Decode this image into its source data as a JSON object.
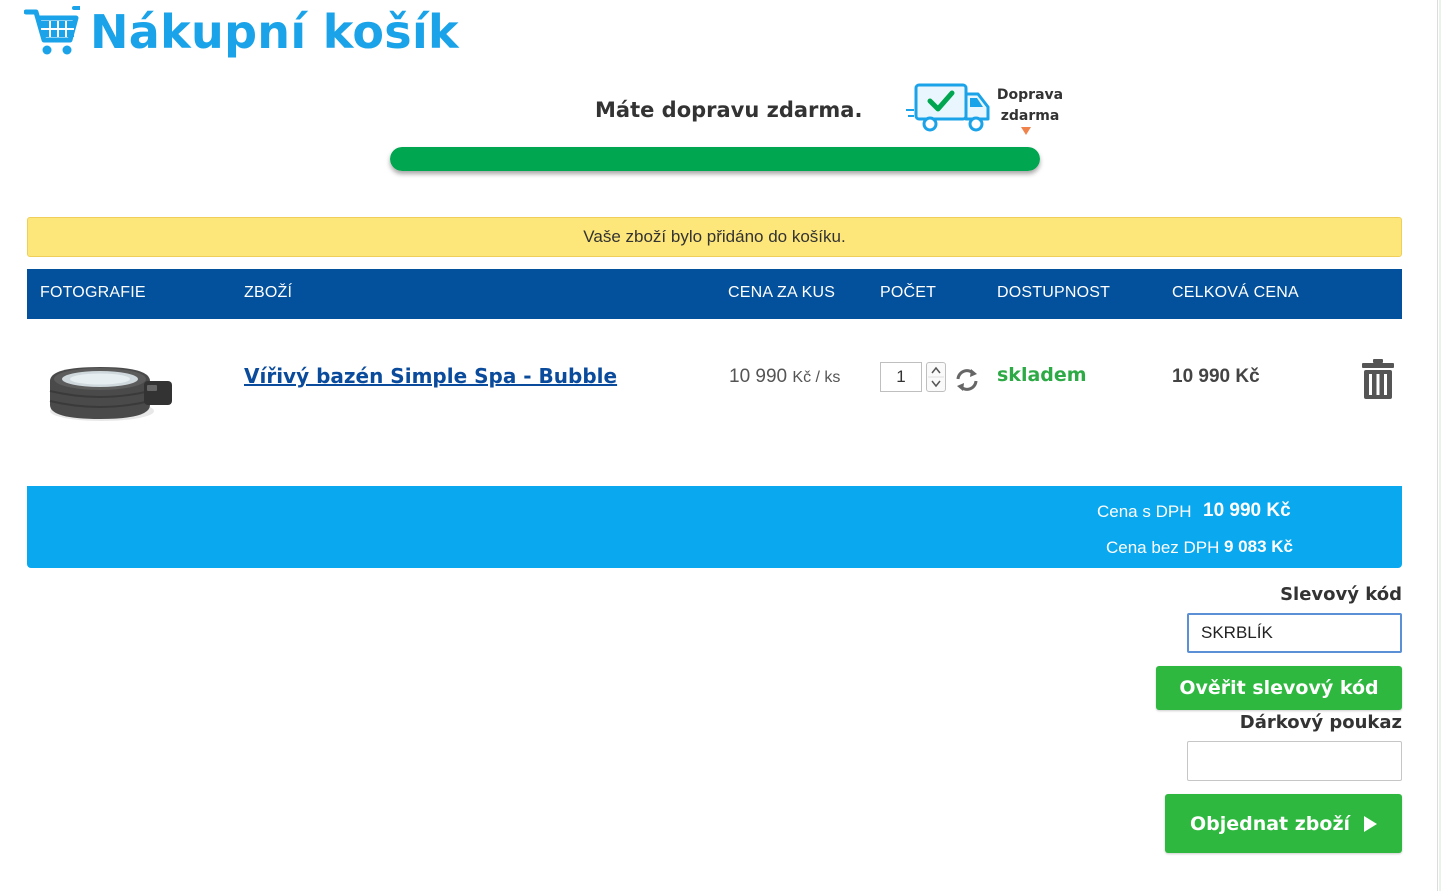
{
  "header": {
    "title": "Nákupní košík"
  },
  "shipping": {
    "message": "Máte dopravu zdarma.",
    "label_line1": "Doprava",
    "label_line2": "zdarma",
    "progress_fraction": 1.0
  },
  "notice": {
    "text": "Vaše zboží bylo přidáno do košíku."
  },
  "table": {
    "headers": [
      "FOTOGRAFIE",
      "ZBOŽÍ",
      "CENA ZA KUS",
      "POČET",
      "DOSTUPNOST",
      "CELKOVÁ CENA"
    ],
    "rows": [
      {
        "name": "Vířivý bazén Simple Spa - Bubble",
        "unit_price_value": "10 990",
        "unit_price_suffix": "Kč / ks",
        "quantity": "1",
        "availability": "skladem",
        "total_value": "10 990",
        "total_currency": "Kč"
      }
    ]
  },
  "summary": {
    "with_vat_label": "Cena s DPH",
    "with_vat_value": "10 990 Kč",
    "without_vat_label": "Cena bez DPH",
    "without_vat_value": "9 083 Kč"
  },
  "discount": {
    "label": "Slevový kód",
    "value": "SKRBLÍK",
    "verify_label": "Ověřit slevový kód"
  },
  "gift": {
    "label": "Dárkový poukaz",
    "value": ""
  },
  "order": {
    "label": "Objednat zboží"
  },
  "colors": {
    "title_blue": "#1aa3e8",
    "table_header_blue": "#03509c",
    "summary_blue": "#0aa8ef",
    "notice_yellow": "#fde67a",
    "progress_green": "#00a650",
    "button_green": "#2eb83f",
    "availability_green": "#2daa46"
  },
  "icons": [
    "shopping-cart-icon",
    "delivery-truck-icon",
    "refresh-icon",
    "trash-icon",
    "play-icon"
  ]
}
